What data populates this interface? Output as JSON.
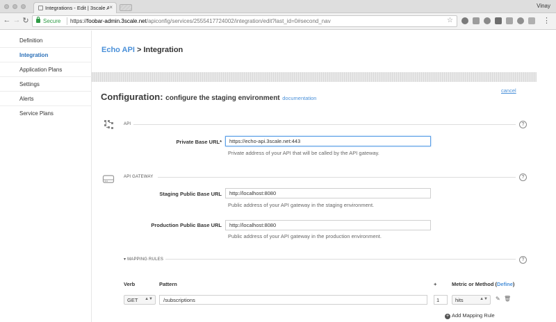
{
  "browser": {
    "tab_title": "Integrations - Edit | 3scale API",
    "tab_close": "×",
    "user": "Vinay",
    "secure_label": "Secure",
    "url_scheme": "https://",
    "url_host": "foobar-admin.3scale.net",
    "url_path": "/apiconfig/services/2555417724002/integration/edit?last_id=0#second_nav"
  },
  "sidebar": {
    "items": [
      {
        "label": "Definition"
      },
      {
        "label": "Integration"
      },
      {
        "label": "Application Plans"
      },
      {
        "label": "Settings"
      },
      {
        "label": "Alerts"
      },
      {
        "label": "Service Plans"
      }
    ]
  },
  "header": {
    "service": "Echo API",
    "separator": " > ",
    "page": "Integration"
  },
  "config": {
    "title": "Configuration:",
    "subtitle": "configure the staging environment",
    "doc_link": "documentation",
    "cancel": "cancel"
  },
  "api": {
    "section": "API",
    "private_label": "Private Base URL*",
    "private_value": "https://echo-api.3scale.net:443",
    "private_hint": "Private address of your API that will be called by the API gateway."
  },
  "gateway": {
    "section": "API GATEWAY",
    "staging_label": "Staging Public Base URL",
    "staging_value": "http://localhost:8080",
    "staging_hint": "Public address of your API gateway in the staging environment.",
    "production_label": "Production Public Base URL",
    "production_value": "http://localhost:8080",
    "production_hint": "Public address of your API gateway in the production environment."
  },
  "mapping": {
    "section": "▾ MAPPING RULES",
    "col_verb": "Verb",
    "col_pattern": "Pattern",
    "col_plus": "+",
    "col_metric": "Metric or Method (",
    "col_define": "Define",
    "col_metric_end": ")",
    "rows": [
      {
        "verb": "GET",
        "pattern": "/subscriptions",
        "delta": "1",
        "metric": "hits"
      }
    ],
    "add_label": "Add Mapping Rule"
  },
  "help_glyph": "?"
}
